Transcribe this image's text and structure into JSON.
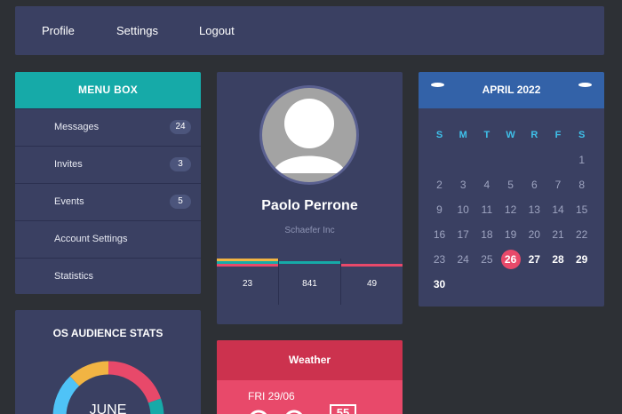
{
  "nav": {
    "items": [
      "Profile",
      "Settings",
      "Logout"
    ]
  },
  "menu_box": {
    "title": "MENU BOX",
    "items": [
      {
        "label": "Messages",
        "badge": "24"
      },
      {
        "label": "Invites",
        "badge": "3"
      },
      {
        "label": "Events",
        "badge": "5"
      },
      {
        "label": "Account Settings",
        "badge": null
      },
      {
        "label": "Statistics",
        "badge": null
      }
    ]
  },
  "profile": {
    "name": "Paolo Perrone",
    "company": "Schaefer Inc",
    "stats": [
      {
        "value": "23",
        "colors": [
          "#f1b443",
          "#16aaa8",
          "#e8496a"
        ]
      },
      {
        "value": "841",
        "colors": [
          "#16aaa8"
        ]
      },
      {
        "value": "49",
        "colors": [
          "#e8496a"
        ]
      }
    ]
  },
  "calendar": {
    "title": "APRIL 2022",
    "weekdays": [
      "S",
      "M",
      "T",
      "W",
      "R",
      "F",
      "S"
    ],
    "rows": [
      [
        "",
        "",
        "",
        "",
        "",
        "",
        "1"
      ],
      [
        "2",
        "3",
        "4",
        "5",
        "6",
        "7",
        "8"
      ],
      [
        "9",
        "10",
        "11",
        "12",
        "13",
        "14",
        "15"
      ],
      [
        "16",
        "17",
        "18",
        "19",
        "20",
        "21",
        "22"
      ],
      [
        "23",
        "24",
        "25",
        "26",
        "27",
        "28",
        "29"
      ],
      [
        "30",
        "",
        "",
        "",
        "",
        "",
        ""
      ]
    ],
    "today": "26",
    "upcoming_days": [
      "27",
      "28",
      "29",
      "30"
    ]
  },
  "os_stats": {
    "title": "OS AUDIENCE STATS",
    "center_label": "JUNE",
    "segment_colors": [
      "#e8496a",
      "#4fc3f7",
      "#f1b443",
      "#16aaa8"
    ]
  },
  "weather": {
    "title": "Weather",
    "date": "FRI 29/06",
    "temp": "55"
  },
  "colors": {
    "bg": "#2d3035",
    "panel": "#3a4062",
    "teal": "#16aaa8",
    "blue": "#3362a8",
    "red": "#e8496a",
    "yellow": "#f1b443"
  }
}
